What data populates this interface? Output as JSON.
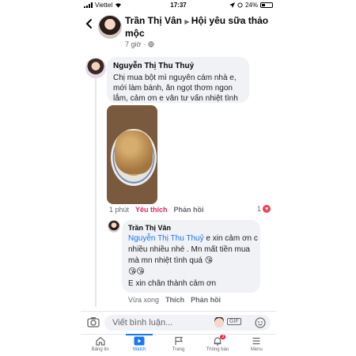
{
  "status_bar": {
    "carrier": "Viettel",
    "time": "17:37",
    "battery": "24%"
  },
  "header": {
    "author": "Trần Thị Vân",
    "group": "Hội yêu sữa thảo mộc",
    "timestamp": "7 giờ"
  },
  "comment1": {
    "author": "Nguyễn Thị Thu Thuỷ",
    "text": "Chị mua bột mì nguyên cám nhà e, mới làm bánh, ăn ngọt thơm ngon lắm, cảm ơn e vân tư vấn nhiệt tình",
    "time": "1 phút",
    "like": "Yêu thích",
    "reply": "Phản hồi",
    "reaction_count": "1"
  },
  "reply1": {
    "author": "Trần Thị Vân",
    "mention": "Nguyễn Thị Thu Thuỷ",
    "text": " e xin cảm ơn c nhiều nhiều nhé . Mn mất tiền mua mà mn nhiệt tình quá 😘",
    "emoji_line": "😘😘",
    "text2": "E xin chân thành cảm ơn",
    "time": "Vừa xong",
    "like": "Thích",
    "reply": "Phản hồi"
  },
  "composer": {
    "placeholder": "Viết bình luận...",
    "gif": "GIF"
  },
  "tabs": [
    {
      "label": "Bảng tin",
      "icon": "home-icon"
    },
    {
      "label": "Watch",
      "icon": "watch-icon"
    },
    {
      "label": "Trang",
      "icon": "flag-icon"
    },
    {
      "label": "Thông báo",
      "icon": "bell-icon",
      "badge": "3"
    },
    {
      "label": "Menu",
      "icon": "menu-icon"
    }
  ],
  "colors": {
    "accent": "#1877f2",
    "liked": "#e0245e",
    "bubble": "#f0f2f5"
  }
}
